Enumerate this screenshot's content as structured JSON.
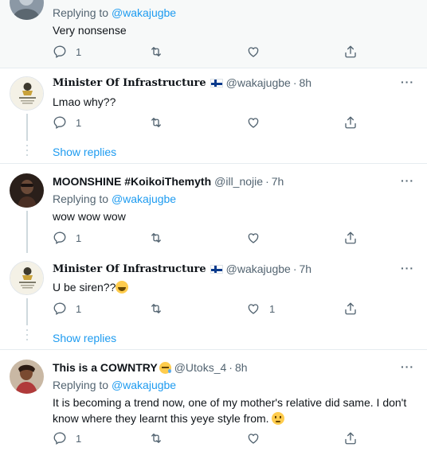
{
  "tweets": [
    {
      "reply_prefix": "Replying to",
      "reply_mention": "@wakajugbe",
      "text": "Very nonsense",
      "replies": "1",
      "retweets": "",
      "likes": ""
    },
    {
      "name": "Minister Of Infrastructure",
      "handle": "@wakajugbe",
      "sep": "·",
      "time": "8h",
      "text": "Lmao why??",
      "replies": "1",
      "retweets": "",
      "likes": "",
      "show_replies": "Show replies"
    },
    {
      "name": "MOONSHINE #KoikoiThemyth",
      "handle": "@ill_nojie",
      "sep": "·",
      "time": "7h",
      "reply_prefix": "Replying to",
      "reply_mention": "@wakajugbe",
      "text": "wow wow wow",
      "replies": "1",
      "retweets": "",
      "likes": ""
    },
    {
      "name": "Minister Of Infrastructure",
      "handle": "@wakajugbe",
      "sep": "·",
      "time": "7h",
      "text": "U be siren??",
      "replies": "1",
      "retweets": "",
      "likes": "1",
      "show_replies": "Show replies"
    },
    {
      "name": "This is a COWNTRY",
      "handle": "@Utoks_4",
      "sep": "·",
      "time": "8h",
      "reply_prefix": "Replying to",
      "reply_mention": "@wakajugbe",
      "text_line1": "It is becoming a trend now, one of my mother's relative did same. I don't",
      "text_line2": "know where they learnt this yeye style from.",
      "replies": "1",
      "retweets": "",
      "likes": ""
    }
  ],
  "more_label": "···",
  "colors": {
    "accent": "#1d9bf0",
    "secondary_text": "#536471",
    "highlight_bg": "#f7f9f9",
    "divider": "#e6ecf0"
  },
  "icons": [
    "reply-icon",
    "retweet-icon",
    "like-icon",
    "share-icon",
    "more-icon",
    "finland-flag-icon",
    "rolling-laughing-emoji",
    "sleepy-face-emoji",
    "slightly-frowning-emoji"
  ]
}
